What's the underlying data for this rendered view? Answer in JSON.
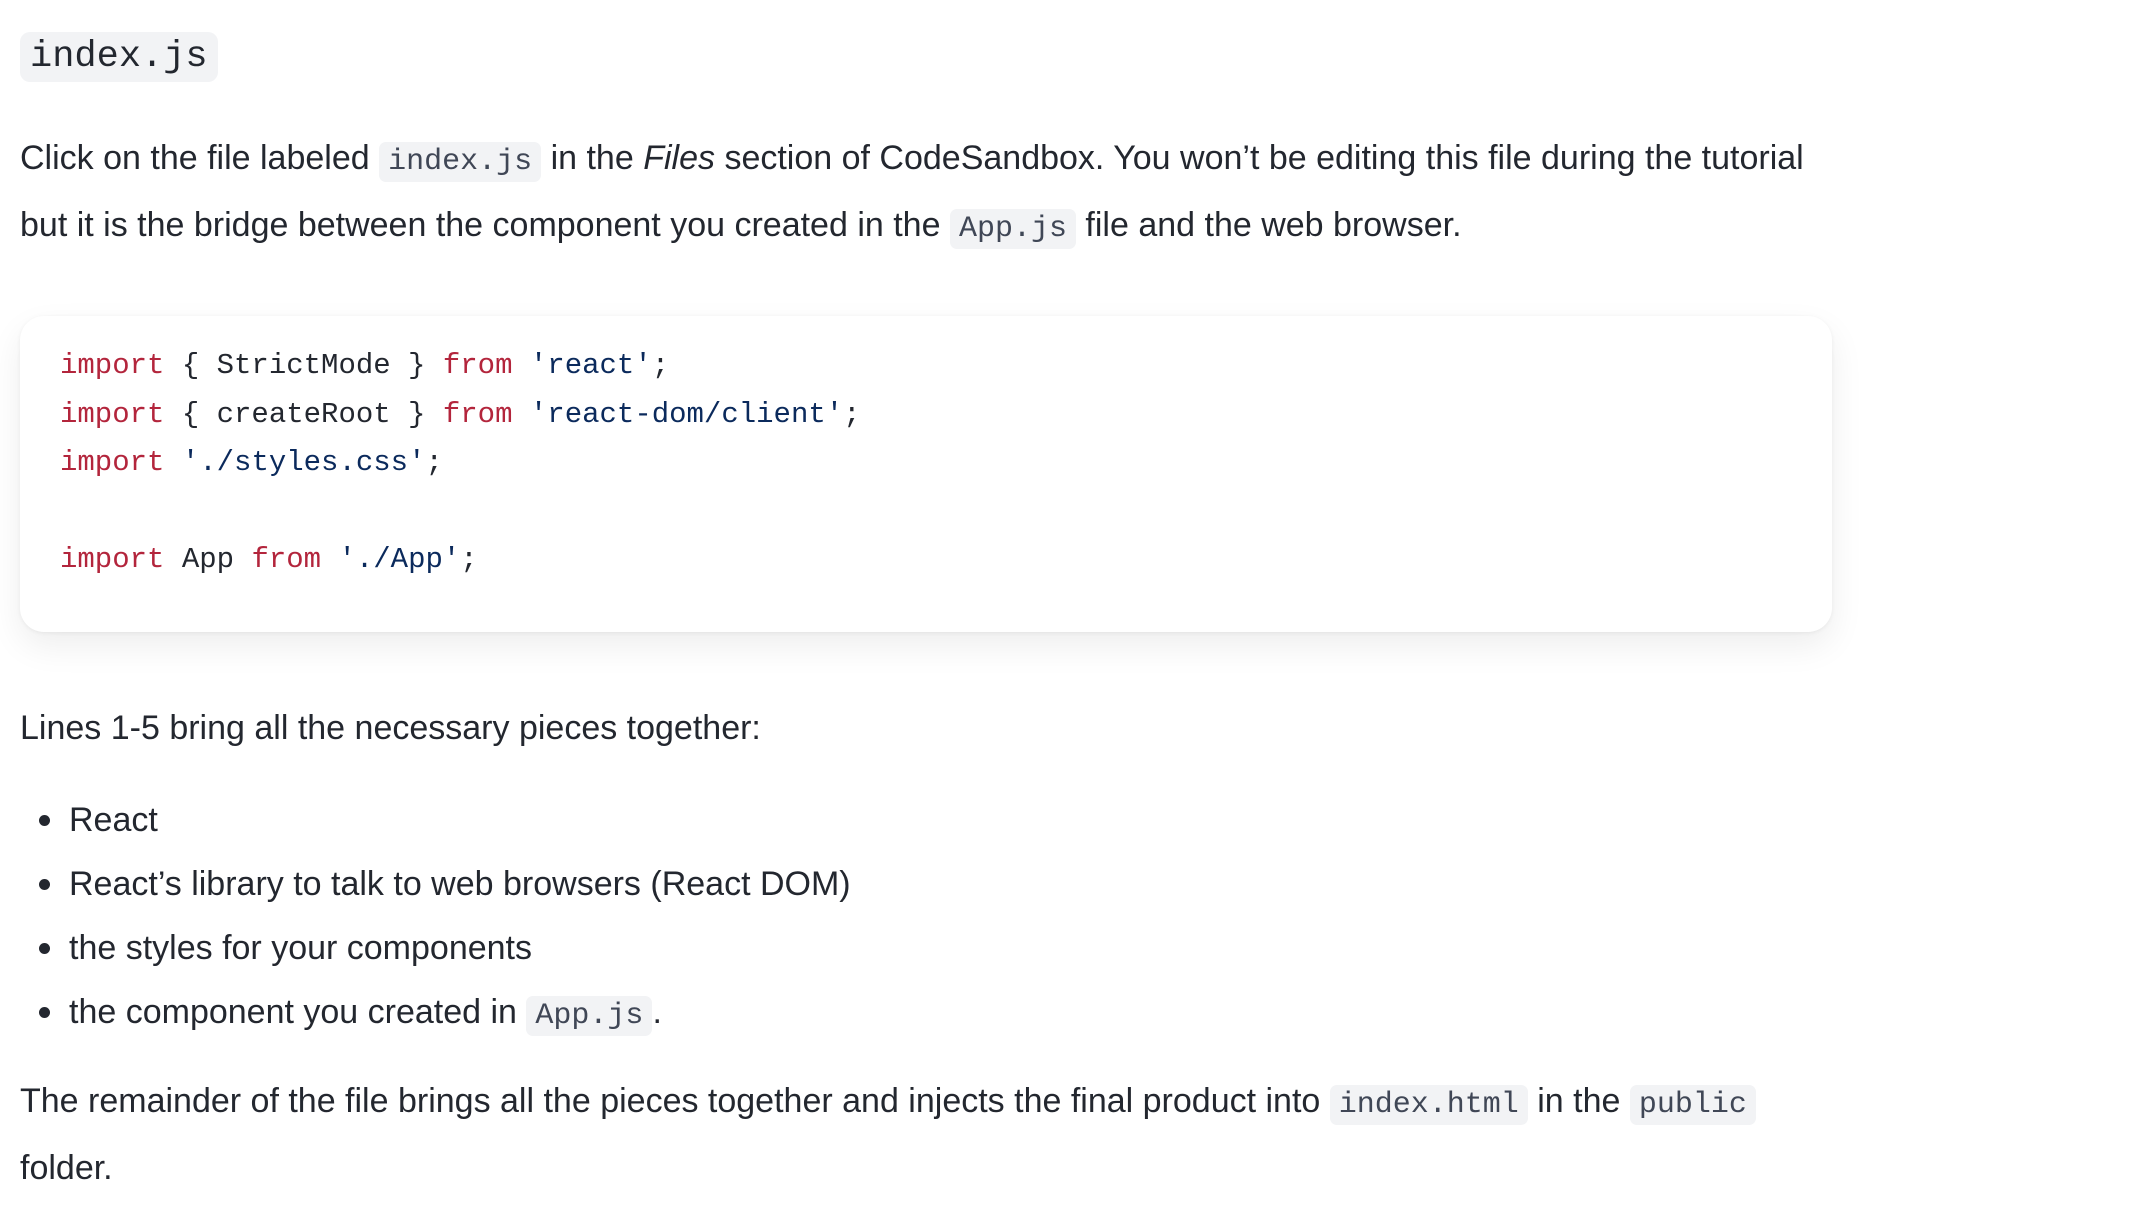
{
  "heading": {
    "filename": "index.js"
  },
  "intro": {
    "part1": "Click on the file labeled ",
    "code1": "index.js",
    "part2": " in the ",
    "em": "Files",
    "part3": " section of CodeSandbox. You won’t be editing this file during the tutorial but it is the bridge between the component you created in the ",
    "code2": "App.js",
    "part4": " file and the web browser."
  },
  "code_block": {
    "lines": [
      {
        "kw1": "import",
        "t1": " { StrictMode } ",
        "kw2": "from",
        "t2": " ",
        "str": "'react'",
        "t3": ";"
      },
      {
        "kw1": "import",
        "t1": " { createRoot } ",
        "kw2": "from",
        "t2": " ",
        "str": "'react-dom/client'",
        "t3": ";"
      },
      {
        "kw1": "import",
        "t1": " ",
        "str": "'./styles.css'",
        "t3": ";"
      },
      {},
      {
        "kw1": "import",
        "t1": " App ",
        "kw2": "from",
        "t2": " ",
        "str": "'./App'",
        "t3": ";"
      }
    ]
  },
  "lines_para": {
    "text": "Lines 1-5 bring all the necessary pieces together:"
  },
  "list": {
    "items": [
      {
        "text": "React"
      },
      {
        "text": "React’s library to talk to web browsers (React DOM)"
      },
      {
        "text": "the styles for your components"
      },
      {
        "text": "the component you created in ",
        "code": "App.js",
        "after": "."
      }
    ]
  },
  "outro": {
    "part1": "The remainder of the file brings all the pieces together and injects the final product into ",
    "code1": "index.html",
    "part2": " in the ",
    "code2": "public",
    "part3": " folder."
  }
}
